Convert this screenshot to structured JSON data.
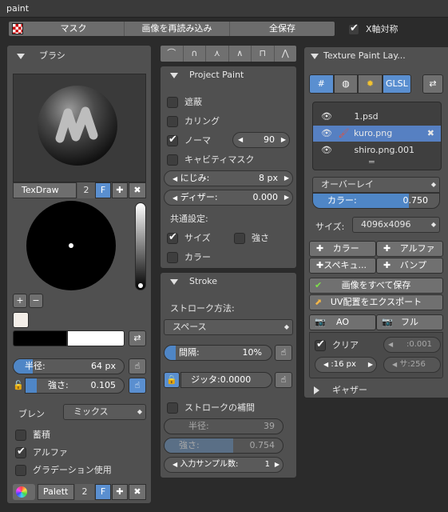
{
  "window": {
    "title": "paint"
  },
  "toolbar": {
    "mask": "マスク",
    "reload": "画像を再読み込み",
    "save_all": "全保存",
    "x_mirror": "X軸対称"
  },
  "brush": {
    "header": "ブラシ",
    "name": "TexDraw",
    "users": "2",
    "fake": "F",
    "radius_label": "半径:",
    "radius_value": "64 px",
    "strength_label": "強さ:",
    "strength_value": "0.105",
    "strength_fraction": 0.105,
    "blend_label": "ブレン",
    "blend_value": "ミックス",
    "accumulate": "蓄積",
    "alpha": "アルファ",
    "gradient": "グラデーション使用",
    "palette_name": "Palett",
    "palette_users": "2",
    "palette_fake": "F"
  },
  "project_paint": {
    "header": "Project Paint",
    "occlude": "遮蔽",
    "culling": "カリング",
    "normal": "ノーマ",
    "normal_value": "90",
    "cavity": "キャビティマスク",
    "bleed_label": "にじみ:",
    "bleed_value": "8 px",
    "dither_label": "ディザー:",
    "dither_value": "0.000",
    "common": "共通設定:",
    "size": "サイズ",
    "strength": "強さ",
    "color": "カラー"
  },
  "stroke": {
    "header": "Stroke",
    "method_label": "ストローク方法:",
    "method_value": "スペース",
    "spacing_label": "間隔:",
    "spacing_value": "10%",
    "spacing_fraction": 0.1,
    "jitter_label": "ジッタ:",
    "jitter_value": "0.0000",
    "smooth": "ストロークの補間",
    "smooth_radius_label": "半径:",
    "smooth_radius_value": "39",
    "smooth_strength_label": "強さ:",
    "smooth_strength_value": "0.754",
    "input_samples_label": "入力サンプル数:",
    "input_samples_value": "1"
  },
  "layers": {
    "header": "Texture Paint Lay...",
    "glsl": "GLSL",
    "items": [
      {
        "name": "1.psd"
      },
      {
        "name": "kuro.png"
      },
      {
        "name": "shiro.png.001"
      }
    ],
    "blend_mode": "オーバーレイ",
    "color_label": "カラー:",
    "color_value": "0.750",
    "color_fraction": 0.75,
    "size_label": "サイズ:",
    "size_value": "4096x4096",
    "add_color": "カラー",
    "add_alpha": "アルファ",
    "add_specular": "スペキュ...",
    "add_bump": "バンプ",
    "save_all_images": "画像をすべて保存",
    "export_uv": "UV配置をエクスポート",
    "bake_ao": "AO",
    "bake_full": "フル",
    "clear": "クリア",
    "clear_value": "0.001",
    "margin_value": "16 px",
    "samples_label": "サ:",
    "samples_value": "256",
    "gather": "ギャザー"
  }
}
